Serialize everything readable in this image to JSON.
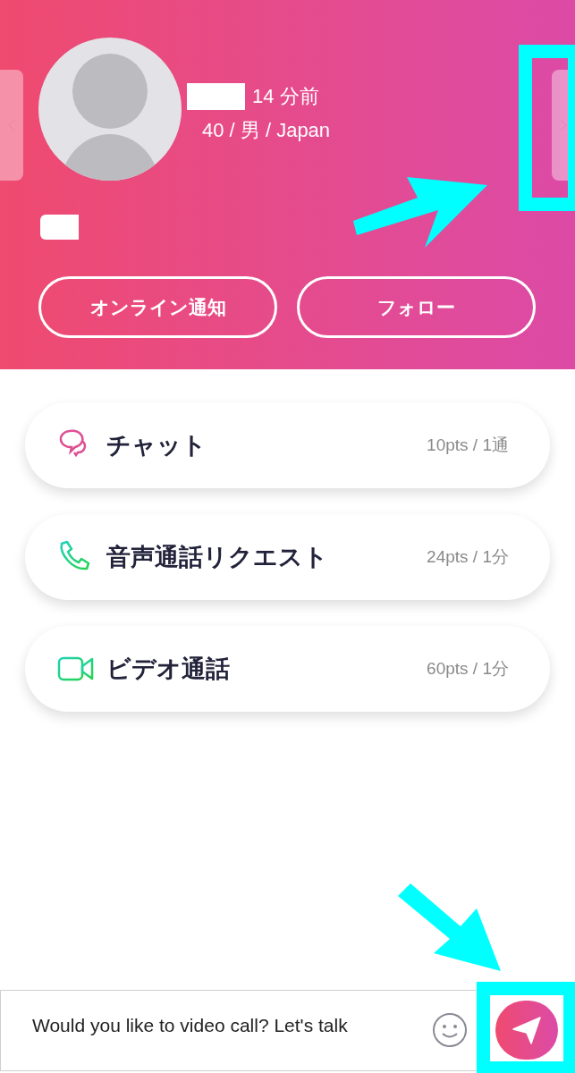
{
  "profile": {
    "last_seen": "14 分前",
    "details": "40 / 男 / Japan"
  },
  "actions": [
    {
      "label": "オンライン通知"
    },
    {
      "label": "フォロー"
    }
  ],
  "services": [
    {
      "kind": "chat",
      "label": "チャット",
      "price": "10pts / 1通"
    },
    {
      "kind": "voice",
      "label": "音声通話リクエスト",
      "price": "24pts / 1分"
    },
    {
      "kind": "video",
      "label": "ビデオ通話",
      "price": "60pts / 1分"
    }
  ],
  "composer": {
    "value": "Would you like to video call? Let's talk"
  }
}
